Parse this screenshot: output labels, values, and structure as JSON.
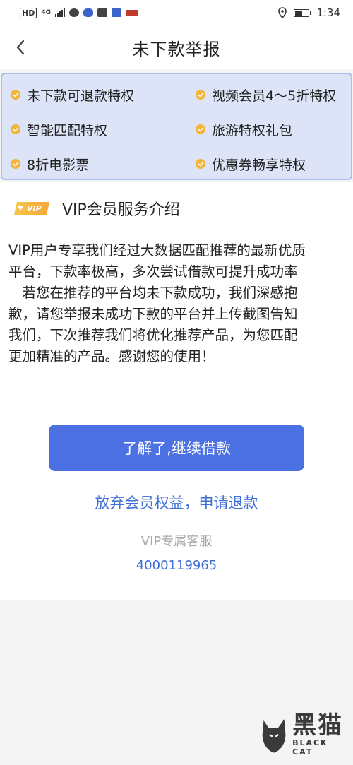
{
  "status_bar": {
    "hd": "HD",
    "signal": "4G",
    "time": "1:34",
    "battery_level": 0.5
  },
  "nav": {
    "title": "未下款举报"
  },
  "perks": [
    {
      "label": "未下款可退款特权"
    },
    {
      "label": "视频会员4～5折特权"
    },
    {
      "label": "智能匹配特权"
    },
    {
      "label": "旅游特权礼包"
    },
    {
      "label": "8折电影票"
    },
    {
      "label": "优惠券畅享特权"
    }
  ],
  "vip": {
    "badge": "VIP",
    "title": "VIP会员服务介绍",
    "lines": [
      "VIP用户专享我们经过大数据匹配推荐的最新优质",
      "平台，下款率极高，多次尝试借款可提升成功率",
      "　若您在推荐的平台均未下款成功，我们深感抱",
      "歉，请您举报未成功下款的平台并上传截图告知",
      "我们，下次推荐我们将优化推荐产品，为您匹配",
      "更加精准的产品。感谢您的使用！"
    ]
  },
  "actions": {
    "continue_label": "了解了,继续借款",
    "refund_label": "放弃会员权益，申请退款"
  },
  "service": {
    "label": "VIP专属客服",
    "phone": "4000119965"
  },
  "watermark": {
    "cn": "黑猫",
    "en": "BLACK CAT"
  },
  "colors": {
    "primary": "#4b71e3",
    "link": "#3d6fd6",
    "perk_bg": "#dde4f7",
    "perk_border": "#aabdf0",
    "dot": "#f4b53a"
  }
}
